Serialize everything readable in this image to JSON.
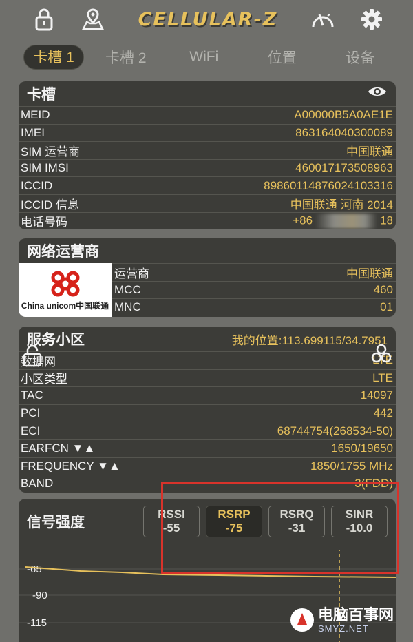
{
  "app": {
    "logo": "CELLULAR-Z"
  },
  "tabs": [
    "卡槽 1",
    "卡槽 2",
    "WiFi",
    "位置",
    "设备"
  ],
  "sim": {
    "title": "卡槽",
    "rows": [
      {
        "k": "MEID",
        "v": "A00000B5A0AE1E"
      },
      {
        "k": "IMEI",
        "v": "863164040300089"
      },
      {
        "k": "SIM 运营商",
        "v": "中国联通"
      },
      {
        "k": "SIM IMSI",
        "v": "460017173508963"
      },
      {
        "k": "ICCID",
        "v": "89860114876024103316"
      },
      {
        "k": "ICCID 信息",
        "v": "中国联通 河南 2014"
      },
      {
        "k": "电话号码",
        "v_pre": "+86",
        "v_post": "18"
      }
    ]
  },
  "network": {
    "title": "网络运营商",
    "logo_text": "China unicom中国联通",
    "rows": [
      {
        "k": "运营商",
        "v": "中国联通"
      },
      {
        "k": "MCC",
        "v": "460"
      },
      {
        "k": "MNC",
        "v": "01"
      }
    ]
  },
  "cell": {
    "title": "服务小区",
    "location": "我的位置:113.699115/34.7951",
    "rows": [
      {
        "k": "数据网",
        "v": "LTE"
      },
      {
        "k": "小区类型",
        "v": "LTE"
      },
      {
        "k": "TAC",
        "v": "14097"
      },
      {
        "k": "PCI",
        "v": "442"
      },
      {
        "k": "ECI",
        "v": "68744754(268534-50)"
      },
      {
        "k": "EARFCN ▼▲",
        "v": "1650/19650"
      },
      {
        "k": "FREQUENCY ▼▲",
        "v": "1850/1755 MHz"
      },
      {
        "k": "BAND",
        "v": "3(FDD)"
      }
    ]
  },
  "signal": {
    "title": "信号强度",
    "badges": [
      {
        "label": "RSSI",
        "value": "-55",
        "active": false
      },
      {
        "label": "RSRP",
        "value": "-75",
        "active": true
      },
      {
        "label": "RSRQ",
        "value": "-31",
        "active": false
      },
      {
        "label": "SINR",
        "value": "-10.0",
        "active": false
      }
    ],
    "ticks": [
      "-65",
      "-90",
      "-115"
    ]
  },
  "watermark": {
    "title": "电脑百事网",
    "sub": "SMYZ.NET"
  },
  "colors": {
    "accent": "#e7c15c",
    "card": "#3c3c38",
    "background": "#6f6f6b",
    "highlight": "#d8332b"
  }
}
